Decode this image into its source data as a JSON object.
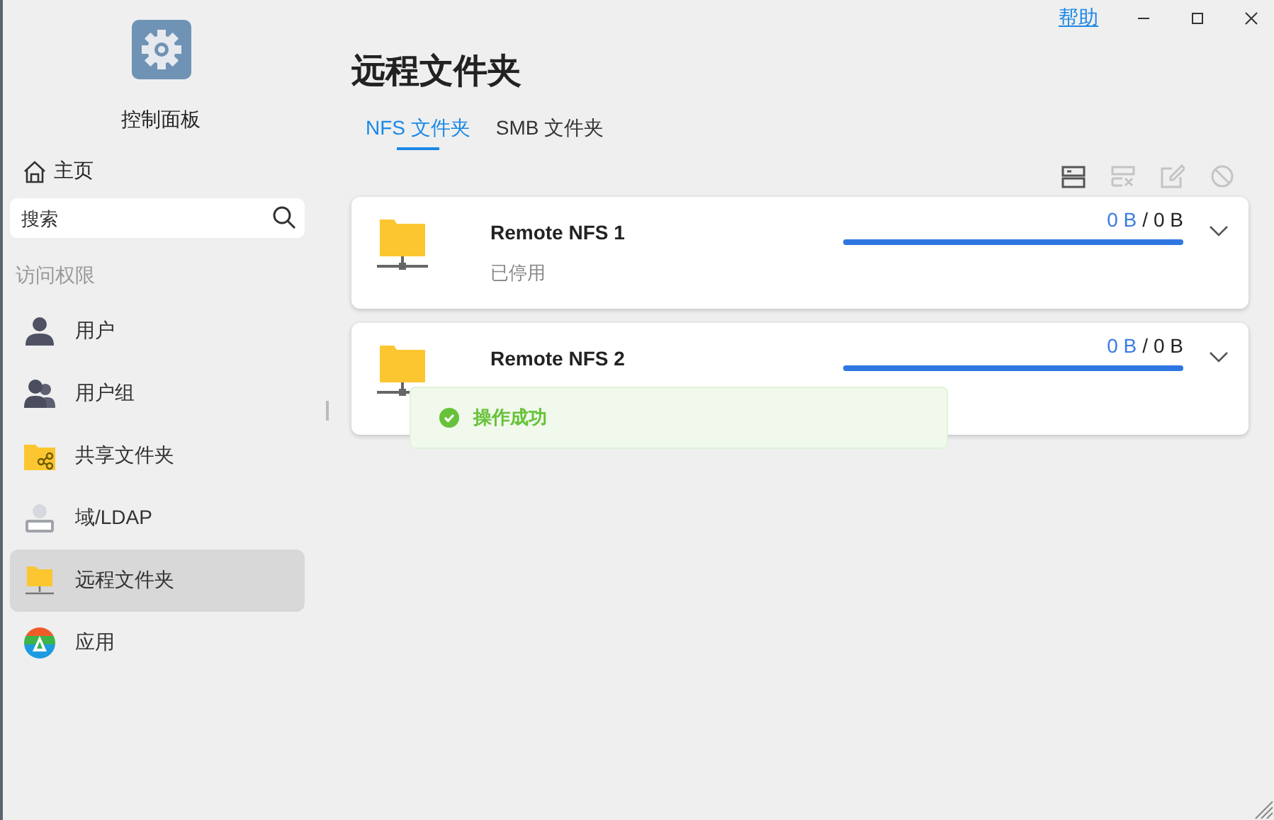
{
  "sidebar": {
    "app_title": "控制面板",
    "home": "主页",
    "search": {
      "placeholder": "搜索"
    },
    "section": "访问权限",
    "items": [
      {
        "label": "用户",
        "kind": "user",
        "selected": false
      },
      {
        "label": "用户组",
        "kind": "group",
        "selected": false
      },
      {
        "label": "共享文件夹",
        "kind": "shared",
        "selected": false
      },
      {
        "label": "域/LDAP",
        "kind": "ldap",
        "selected": false
      },
      {
        "label": "远程文件夹",
        "kind": "remote",
        "selected": true
      },
      {
        "label": "应用",
        "kind": "app",
        "selected": false
      }
    ]
  },
  "header": {
    "help": "帮助",
    "title": "远程文件夹"
  },
  "tabs": [
    {
      "label": "NFS 文件夹",
      "selected": true
    },
    {
      "label": "SMB 文件夹",
      "selected": false
    }
  ],
  "toolbar": [
    {
      "kind": "server",
      "disabled": false
    },
    {
      "kind": "unmount",
      "disabled": true
    },
    {
      "kind": "edit",
      "disabled": true
    },
    {
      "kind": "block",
      "disabled": true
    }
  ],
  "folders": [
    {
      "name": "Remote NFS 1",
      "status": "已停用",
      "used": "0 B",
      "separator": "/",
      "total": "0 B",
      "level": 1
    },
    {
      "name": "Remote NFS 2",
      "used": "0 B",
      "separator": "/",
      "total": "0 B",
      "level": 1
    }
  ],
  "toast": {
    "message": "操作成功"
  }
}
